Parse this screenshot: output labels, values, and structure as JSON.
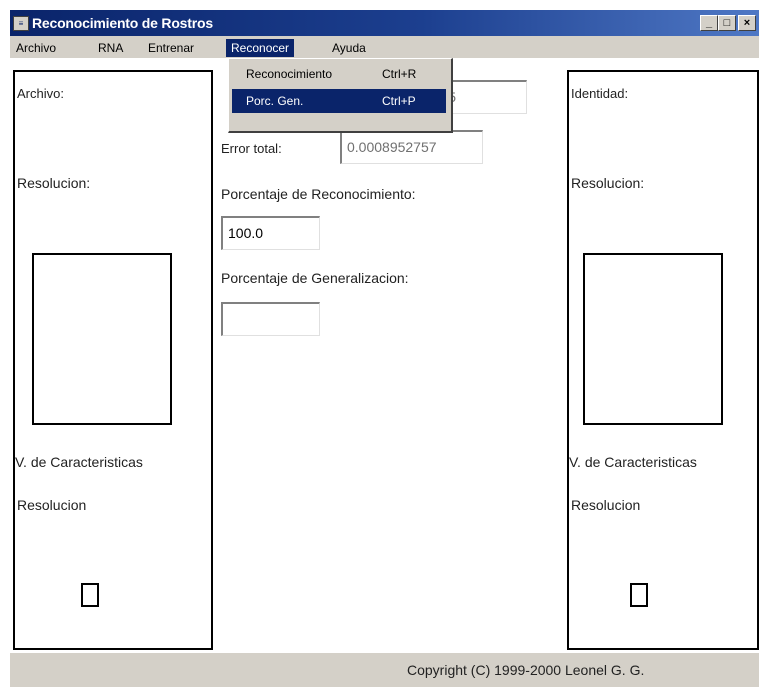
{
  "window": {
    "title": "Reconocimiento de Rostros",
    "minimize_glyph": "_",
    "maximize_glyph": "□",
    "close_glyph": "×"
  },
  "menu": {
    "items": [
      "Archivo",
      "RNA",
      "Entrenar",
      "Reconocer",
      "Ayuda"
    ],
    "active": "Reconocer"
  },
  "dropdown": {
    "items": [
      {
        "label": "Reconocimiento",
        "shortcut": "Ctrl+R"
      },
      {
        "label": "Porc. Gen.",
        "shortcut": "Ctrl+P"
      }
    ],
    "selected_index": 1
  },
  "left_panel": {
    "archivo_label": "Archivo:",
    "resolucion_label": "Resolucion:",
    "caracteristicas_label": "V. de Caracteristicas",
    "resolucion2_label": "Resolucion"
  },
  "center": {
    "top_field_value": "5",
    "error_label": "Error total:",
    "error_value": "0.0008952757",
    "reconocimiento_label": "Porcentaje de Reconocimiento:",
    "reconocimiento_value": "100.0",
    "generalizacion_label": "Porcentaje de Generalizacion:",
    "generalizacion_value": ""
  },
  "right_panel": {
    "identidad_label": "Identidad:",
    "resolucion_label": "Resolucion:",
    "caracteristicas_label": "V. de Caracteristicas",
    "resolucion2_label": "Resolucion"
  },
  "status": {
    "copyright": "Copyright (C) 1999-2000 Leonel G. G."
  },
  "colors": {
    "titlebar": "#0a246a",
    "menu_highlight": "#0a246a",
    "chrome": "#d4d0c8"
  }
}
